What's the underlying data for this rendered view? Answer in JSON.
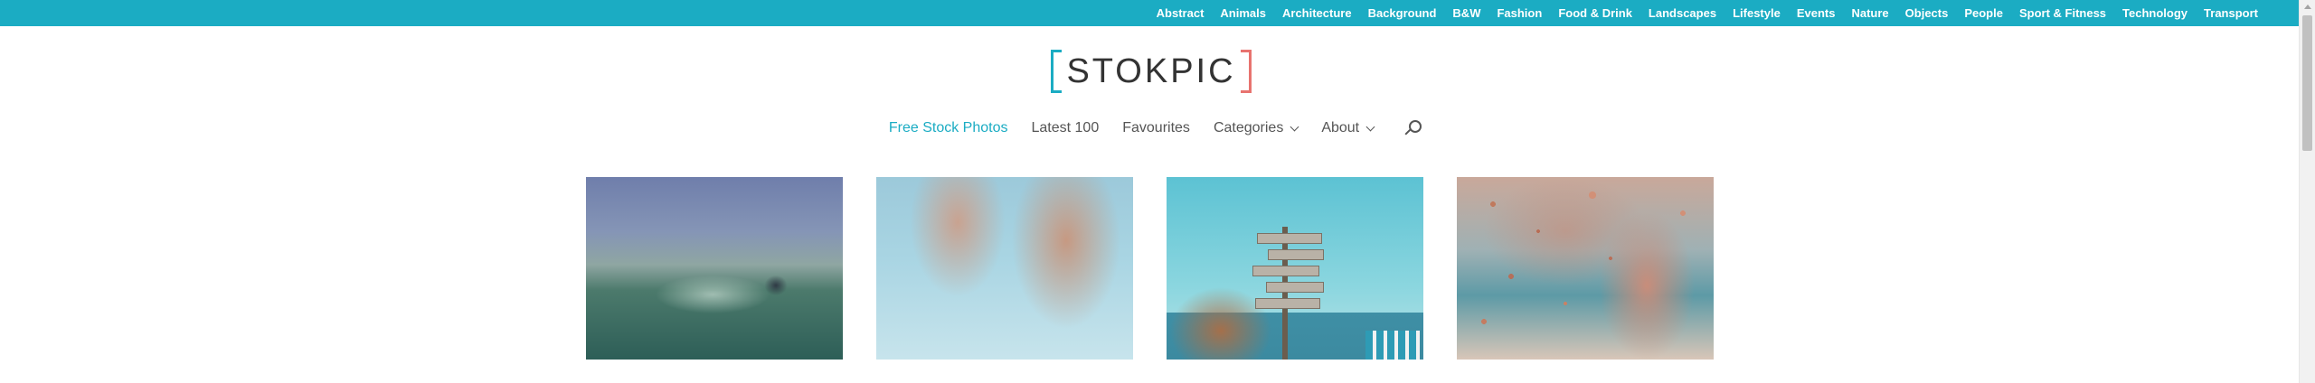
{
  "top_categories": [
    "Abstract",
    "Animals",
    "Architecture",
    "Background",
    "B&W",
    "Fashion",
    "Food & Drink",
    "Landscapes",
    "Lifestyle",
    "Events",
    "Nature",
    "Objects",
    "People",
    "Sport & Fitness",
    "Technology",
    "Transport"
  ],
  "logo": {
    "text": "STOKPIC"
  },
  "nav": {
    "free_stock_photos": "Free Stock Photos",
    "latest_100": "Latest 100",
    "favourites": "Favourites",
    "categories": "Categories",
    "about": "About",
    "search_icon": "search-icon",
    "caret_icon": "chevron-down-icon"
  },
  "photos": [
    {
      "subject": "water-splash"
    },
    {
      "subject": "women-legs-sky"
    },
    {
      "subject": "beach-signpost"
    },
    {
      "subject": "woman-beach-sand"
    }
  ],
  "colors": {
    "accent": "#1bacc3",
    "logo_bracket_left": "#1bacc3",
    "logo_bracket_right": "#e8736f",
    "nav_text": "#555555"
  }
}
